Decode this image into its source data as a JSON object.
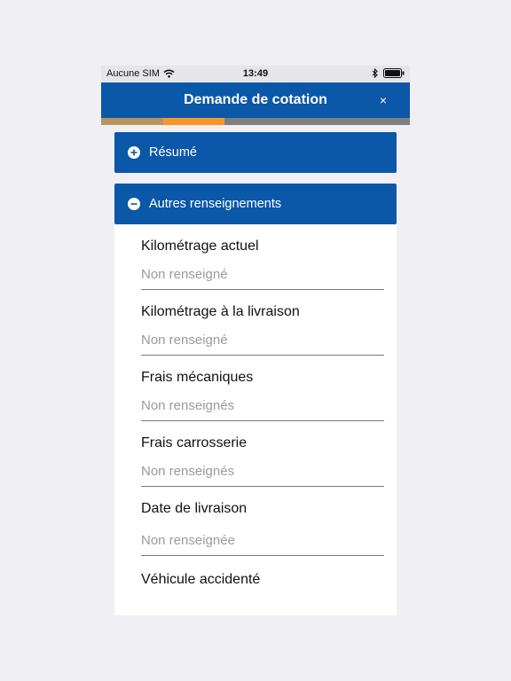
{
  "status_bar": {
    "carrier": "Aucune SIM",
    "time": "13:49"
  },
  "navbar": {
    "title": "Demande de cotation",
    "close_label": "×"
  },
  "progress": {
    "completed_steps": 2,
    "total_steps": 5
  },
  "colors": {
    "primary": "#0b57a8",
    "progress_done": "#b89560",
    "progress_current": "#f5982a"
  },
  "sections": {
    "resume": {
      "title": "Résumé",
      "icon": "plus-circle-icon"
    },
    "autres": {
      "title": "Autres renseignements",
      "icon": "minus-circle-icon"
    }
  },
  "fields": [
    {
      "label": "Kilométrage actuel",
      "value": "Non renseigné"
    },
    {
      "label": "Kilométrage à la livraison",
      "value": "Non renseigné"
    },
    {
      "label": "Frais mécaniques",
      "value": "Non renseignés"
    },
    {
      "label": "Frais carrosserie",
      "value": "Non renseignés"
    },
    {
      "label": "Date de livraison",
      "value": "Non renseignée"
    },
    {
      "label": "Véhicule accidenté",
      "value": ""
    }
  ]
}
